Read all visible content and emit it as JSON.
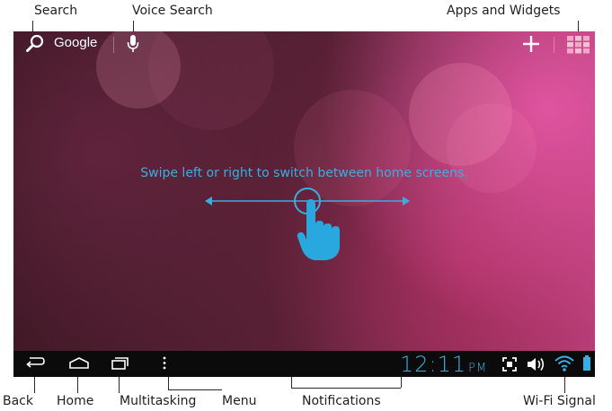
{
  "callouts": {
    "search": "Search",
    "voice_search": "Voice Search",
    "apps_widgets": "Apps and Widgets",
    "back": "Back",
    "home": "Home",
    "multitasking": "Multitasking",
    "menu": "Menu",
    "notifications": "Notifications",
    "wifi_signal": "Wi-Fi Signal"
  },
  "topbar": {
    "search_label": "Google",
    "icons": [
      "search-icon",
      "microphone-icon",
      "add-icon",
      "apps-grid-icon"
    ]
  },
  "home": {
    "hint_text": "Swipe left or right to switch between home screens.",
    "hint_color": "#3aaee0"
  },
  "statusbar": {
    "time": "12:11",
    "ampm": "PM",
    "icons": [
      "screenshot-icon",
      "volume-icon",
      "wifi-icon",
      "battery-icon"
    ],
    "accent": "#3aaee0"
  },
  "navbar": {
    "icons": [
      "back-icon",
      "home-icon",
      "recent-apps-icon",
      "menu-icon"
    ]
  }
}
